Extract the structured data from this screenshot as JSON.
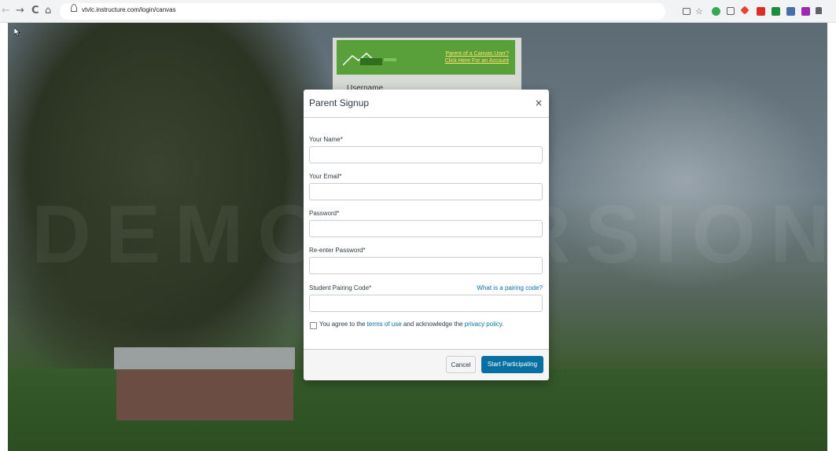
{
  "browser": {
    "url": "vtvlc.instructure.com/login/canvas",
    "nav": {
      "back": "←",
      "forward": "→",
      "reload": "C",
      "home": "⌂"
    },
    "toolbar_icons": [
      {
        "name": "reading-list-icon",
        "color": "#5f6368"
      },
      {
        "name": "bookmark-star-icon",
        "color": "#5f6368"
      },
      {
        "name": "green-extension-icon",
        "color": "#34a853"
      },
      {
        "name": "cast-icon",
        "color": "#5f6368"
      },
      {
        "name": "diamond-extension-icon",
        "color": "#ea4335"
      },
      {
        "name": "gmail-icon",
        "color": "#d93025"
      },
      {
        "name": "green-square-extension-icon",
        "color": "#1e8e3e"
      },
      {
        "name": "blue-square-extension-icon",
        "color": "#4a6ea9"
      },
      {
        "name": "purple-extension-icon",
        "color": "#9c27b0"
      },
      {
        "name": "puzzle-extensions-icon",
        "color": "#5f6368"
      }
    ]
  },
  "background": {
    "watermark": "DEMO VERSION"
  },
  "login_card": {
    "link_line1": "Parent of a Canvas User?",
    "link_line2": "Click Here For an Account",
    "username_label": "Username"
  },
  "modal": {
    "title": "Parent Signup",
    "close": "×",
    "fields": {
      "name_label": "Your Name*",
      "email_label": "Your Email*",
      "password_label": "Password*",
      "reenter_label": "Re-enter Password*",
      "pairing_label": "Student Pairing Code*"
    },
    "pairing_help": "What is a pairing code?",
    "agree": {
      "pre": "You agree to the ",
      "terms": "terms of use",
      "mid": " and acknowledge the ",
      "privacy": "privacy policy",
      "post": "."
    },
    "cancel": "Cancel",
    "submit": "Start Participating"
  }
}
